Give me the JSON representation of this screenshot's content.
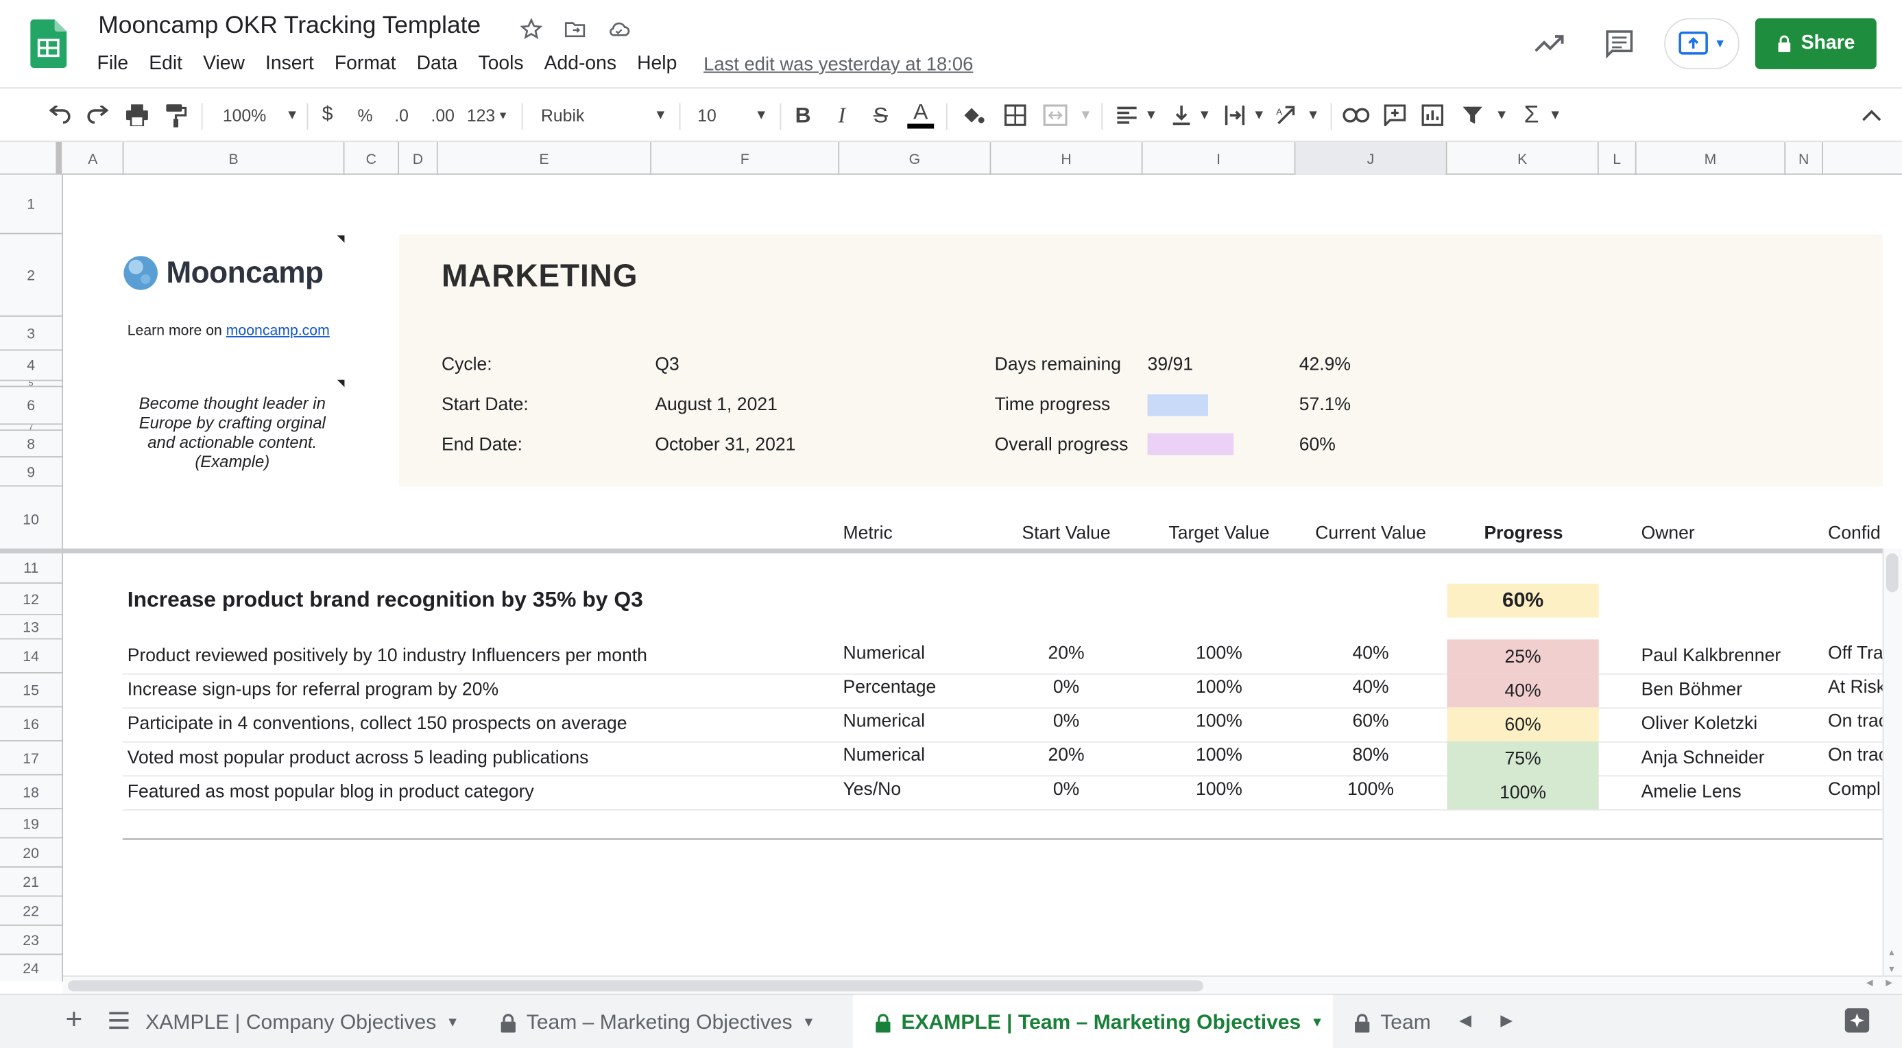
{
  "app": {
    "title": "Mooncamp OKR Tracking Template",
    "last_edit": "Last edit was yesterday at 18:06",
    "share_label": "Share"
  },
  "menu": [
    "File",
    "Edit",
    "View",
    "Insert",
    "Format",
    "Data",
    "Tools",
    "Add-ons",
    "Help"
  ],
  "toolbar": {
    "zoom": "100%",
    "currency": "$",
    "percent": "%",
    "dec_decrease": ".0",
    "dec_increase": ".00",
    "more_formats": "123",
    "font": "Rubik",
    "font_size": "10",
    "bold": "B",
    "italic": "I",
    "strike": "S",
    "text_color": "A"
  },
  "columns": [
    "A",
    "B",
    "C",
    "D",
    "E",
    "F",
    "G",
    "H",
    "I",
    "J",
    "K",
    "L",
    "M",
    "N"
  ],
  "rows": [
    "1",
    "2",
    "3",
    "4",
    "5",
    "6",
    "7",
    "8",
    "9",
    "10",
    "11",
    "12",
    "13",
    "14",
    "15",
    "16",
    "17",
    "18",
    "19",
    "20",
    "21",
    "22",
    "23",
    "24"
  ],
  "sidebar": {
    "brand": "Mooncamp",
    "learn_more": "Learn more on",
    "learn_link": "mooncamp.com",
    "objective_text": "Become thought leader in Europe by crafting orginal and actionable content. (Example)"
  },
  "panel": {
    "heading": "MARKETING",
    "cycle_label": "Cycle:",
    "cycle_value": "Q3",
    "start_label": "Start Date:",
    "start_value": "August 1, 2021",
    "end_label": "End Date:",
    "end_value": "October 31, 2021",
    "days_label": "Days remaining",
    "days_value": "39/91",
    "days_pct": "42.9%",
    "time_label": "Time progress",
    "time_pct": "57.1%",
    "time_fraction": 0.571,
    "time_color": "#c9daf8",
    "overall_label": "Overall progress",
    "overall_pct": "60%",
    "overall_fraction": 0.6,
    "overall_color": "#ead1f5"
  },
  "table_headers": {
    "metric": "Metric",
    "start": "Start Value",
    "target": "Target Value",
    "current": "Current Value",
    "progress": "Progress",
    "owner": "Owner",
    "confidence": "Confid"
  },
  "objective": {
    "title": "Increase product brand recognition by 35% by Q3",
    "progress": "60%",
    "progress_color": "#fdf0c4"
  },
  "key_results": [
    {
      "title": "Product reviewed positively by 10 industry Influencers per month",
      "metric": "Numerical",
      "start": "20%",
      "target": "100%",
      "current": "40%",
      "progress": "25%",
      "progress_color": "#f1cfcf",
      "owner": "Paul Kalkbrenner",
      "confidence": "Off Tra"
    },
    {
      "title": "Increase sign-ups for referral program by 20%",
      "metric": "Percentage",
      "start": "0%",
      "target": "100%",
      "current": "40%",
      "progress": "40%",
      "progress_color": "#f1cfcf",
      "owner": "Ben Böhmer",
      "confidence": "At Risk"
    },
    {
      "title": "Participate in 4 conventions, collect 150 prospects on average",
      "metric": "Numerical",
      "start": "0%",
      "target": "100%",
      "current": "60%",
      "progress": "60%",
      "progress_color": "#fdf0c4",
      "owner": "Oliver Koletzki",
      "confidence": "On trac"
    },
    {
      "title": "Voted most popular product across 5 leading publications",
      "metric": "Numerical",
      "start": "20%",
      "target": "100%",
      "current": "80%",
      "progress": "75%",
      "progress_color": "#d5e8d0",
      "owner": "Anja Schneider",
      "confidence": "On trac"
    },
    {
      "title": "Featured as most popular blog in product category",
      "metric": "Yes/No",
      "start": "0%",
      "target": "100%",
      "current": "100%",
      "progress": "100%",
      "progress_color": "#d5e8d0",
      "owner": "Amelie Lens",
      "confidence": "Compl"
    }
  ],
  "sheet_tabs": [
    "XAMPLE | Company Objectives",
    "Team – Marketing Objectives",
    "EXAMPLE | Team – Marketing Objectives",
    "Team"
  ],
  "colors": {
    "accent": "#188038",
    "share_bg": "#1e8e3e"
  }
}
